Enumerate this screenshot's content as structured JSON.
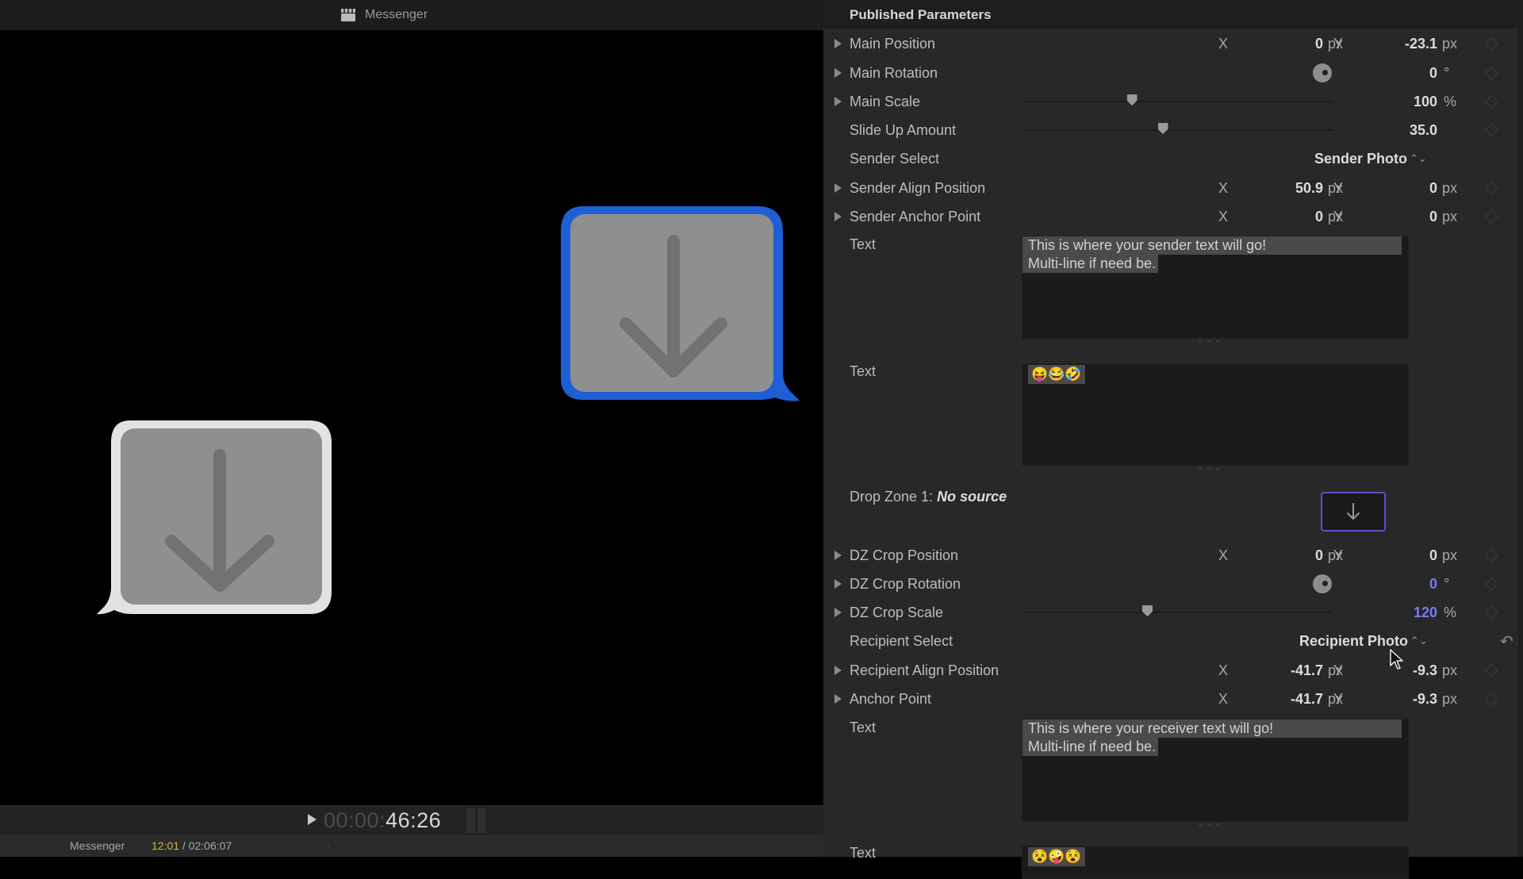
{
  "viewer": {
    "title": "Messenger",
    "title_icon": "clapperboard-icon",
    "timecode_dim": "00:00:",
    "timecode_bright": "46:26",
    "status": {
      "project_name": "Messenger",
      "current_time": "12:01",
      "separator": " / ",
      "total_duration": "02:06:07"
    },
    "bubbles": [
      {
        "role": "sender",
        "border_color": "#1f5fd6",
        "fill_color": "#8f8f8f",
        "icon": "drop-zone-arrow-icon"
      },
      {
        "role": "recipient",
        "border_color": "#e2e2e4",
        "fill_color": "#8f8f8f",
        "icon": "drop-zone-arrow-icon"
      }
    ]
  },
  "inspector": {
    "title": "Published Parameters",
    "accent_color": "#5a52c8",
    "modified_value_color": "#7b7bf0",
    "params": {
      "main_position": {
        "label": "Main Position",
        "x": "0",
        "y": "-23.1",
        "unit": "px"
      },
      "main_rotation": {
        "label": "Main Rotation",
        "value": "0",
        "unit": "°"
      },
      "main_scale": {
        "label": "Main Scale",
        "value": "100",
        "unit": "%",
        "slider_fraction": 0.35
      },
      "slide_up_amount": {
        "label": "Slide Up Amount",
        "value": "35.0",
        "slider_fraction": 0.45
      },
      "sender_select": {
        "label": "Sender Select",
        "value": "Sender Photo"
      },
      "sender_align_position": {
        "label": "Sender Align Position",
        "x": "50.9",
        "y": "0",
        "unit": "px"
      },
      "sender_anchor_point": {
        "label": "Sender Anchor Point",
        "x": "0",
        "y": "0",
        "unit": "px"
      },
      "sender_text": {
        "label": "Text",
        "line1": "This is where your sender text will go!",
        "line2": "Multi-line if need be."
      },
      "sender_emoji": {
        "label": "Text",
        "value": "😝😂🤣"
      },
      "drop_zone": {
        "label": "Drop Zone 1:",
        "status": "No source"
      },
      "dz_crop_position": {
        "label": "DZ Crop Position",
        "x": "0",
        "y": "0",
        "unit": "px"
      },
      "dz_crop_rotation": {
        "label": "DZ Crop Rotation",
        "value": "0",
        "unit": "°"
      },
      "dz_crop_scale": {
        "label": "DZ Crop Scale",
        "value": "120",
        "unit": "%",
        "slider_fraction": 0.4
      },
      "recipient_select": {
        "label": "Recipient Select",
        "value": "Recipient Photo"
      },
      "recipient_align_position": {
        "label": "Recipient Align Position",
        "x": "-41.7",
        "y": "-9.3",
        "unit": "px"
      },
      "anchor_point": {
        "label": "Anchor Point",
        "x": "-41.7",
        "y": "-9.3",
        "unit": "px"
      },
      "recipient_text": {
        "label": "Text",
        "line1": "This is where your receiver text will go!",
        "line2": "Multi-line if need be."
      },
      "recipient_emoji": {
        "label": "Text",
        "value": "😵🤪😵"
      }
    },
    "axis_x": "X",
    "axis_y": "Y"
  }
}
